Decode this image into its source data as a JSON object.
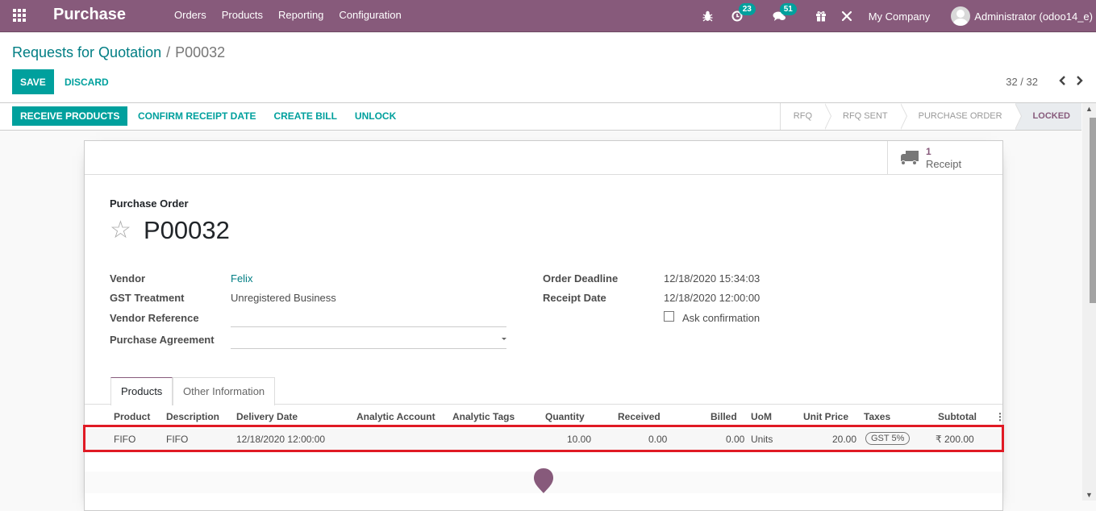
{
  "navbar": {
    "app_name": "Purchase",
    "menu": [
      "Orders",
      "Products",
      "Reporting",
      "Configuration"
    ],
    "activity_count": "23",
    "messages_count": "51",
    "company": "My Company",
    "user": "Administrator (odoo14_e)"
  },
  "control_panel": {
    "breadcrumb_parent": "Requests for Quotation",
    "breadcrumb_separator": "/",
    "breadcrumb_current": "P00032",
    "save_label": "SAVE",
    "discard_label": "DISCARD",
    "pager_value": "32 / 32"
  },
  "statusbar": {
    "receive_products": "RECEIVE PRODUCTS",
    "confirm_receipt_date": "CONFIRM RECEIPT DATE",
    "create_bill": "CREATE BILL",
    "unlock": "UNLOCK",
    "stages": [
      "RFQ",
      "RFQ SENT",
      "PURCHASE ORDER",
      "LOCKED"
    ],
    "active_stage": "LOCKED"
  },
  "smart_button": {
    "count": "1",
    "label": "Receipt"
  },
  "form": {
    "title_label": "Purchase Order",
    "name": "P00032",
    "left_fields": {
      "vendor_label": "Vendor",
      "vendor_value": "Felix",
      "gst_label": "GST Treatment",
      "gst_value": "Unregistered Business",
      "vendor_ref_label": "Vendor Reference",
      "vendor_ref_value": "",
      "agreement_label": "Purchase Agreement",
      "agreement_value": ""
    },
    "right_fields": {
      "deadline_label": "Order Deadline",
      "deadline_value": "12/18/2020 15:34:03",
      "receipt_date_label": "Receipt Date",
      "receipt_date_value": "12/18/2020 12:00:00",
      "ask_confirmation_label": "Ask confirmation",
      "ask_confirmation_checked": false
    }
  },
  "tabs": [
    "Products",
    "Other Information"
  ],
  "active_tab": "Products",
  "order_lines": {
    "columns": [
      "Product",
      "Description",
      "Delivery Date",
      "Analytic Account",
      "Analytic Tags",
      "Quantity",
      "Received",
      "Billed",
      "UoM",
      "Unit Price",
      "Taxes",
      "Subtotal"
    ],
    "rows": [
      {
        "product": "FIFO",
        "description": "FIFO",
        "delivery_date": "12/18/2020 12:00:00",
        "analytic_account": "",
        "analytic_tags": "",
        "quantity": "10.00",
        "received": "0.00",
        "billed": "0.00",
        "uom": "Units",
        "unit_price": "20.00",
        "taxes": "GST 5%",
        "subtotal": "₹ 200.00"
      }
    ]
  },
  "colors": {
    "brand": "#875a7b",
    "primary": "#00a09d",
    "highlight": "#e01a24"
  }
}
